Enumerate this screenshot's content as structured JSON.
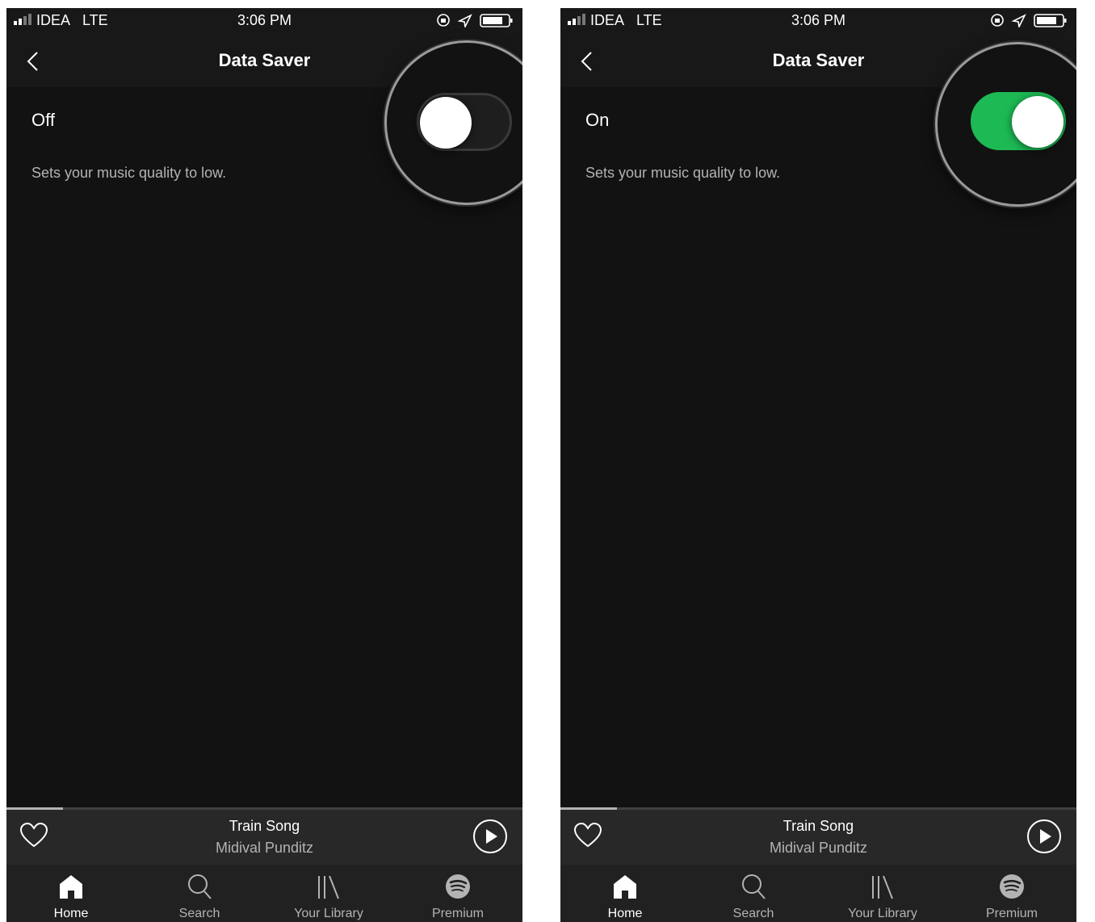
{
  "screens": [
    {
      "status": {
        "carrier": "IDEA",
        "network": "LTE",
        "time": "3:06 PM"
      },
      "nav": {
        "title": "Data Saver"
      },
      "setting": {
        "state_label": "Off",
        "description": "Sets your music quality to low.",
        "enabled": false
      },
      "player": {
        "title": "Train Song",
        "artist": "Midival Punditz",
        "progress": 0.11
      },
      "tabs": [
        {
          "label": "Home",
          "icon": "home-icon",
          "active": true
        },
        {
          "label": "Search",
          "icon": "search-icon",
          "active": false
        },
        {
          "label": "Your Library",
          "icon": "library-icon",
          "active": false
        },
        {
          "label": "Premium",
          "icon": "spotify-icon",
          "active": false
        }
      ]
    },
    {
      "status": {
        "carrier": "IDEA",
        "network": "LTE",
        "time": "3:06 PM"
      },
      "nav": {
        "title": "Data Saver"
      },
      "setting": {
        "state_label": "On",
        "description": "Sets your music quality to low.",
        "enabled": true
      },
      "player": {
        "title": "Train Song",
        "artist": "Midival Punditz",
        "progress": 0.11
      },
      "tabs": [
        {
          "label": "Home",
          "icon": "home-icon",
          "active": true
        },
        {
          "label": "Search",
          "icon": "search-icon",
          "active": false
        },
        {
          "label": "Your Library",
          "icon": "library-icon",
          "active": false
        },
        {
          "label": "Premium",
          "icon": "spotify-icon",
          "active": false
        }
      ]
    }
  ],
  "colors": {
    "background": "#121212",
    "bar": "#181818",
    "player": "#282828",
    "tabbar": "#212121",
    "accent": "#1db954",
    "text_primary": "#ffffff",
    "text_secondary": "#b3b3b3"
  }
}
